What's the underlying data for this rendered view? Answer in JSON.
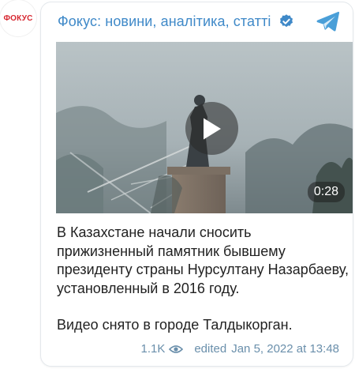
{
  "avatar": {
    "label": "ФОКУС",
    "color": "#d7262f"
  },
  "channel": {
    "title": "Фокус: новини, аналітика, статті",
    "title_color": "#3f89c8",
    "verified_icon": "verified-badge-icon",
    "share_icon": "telegram-icon"
  },
  "video": {
    "duration": "0:28",
    "play_icon": "play-icon"
  },
  "post": {
    "paragraph1": "В Казахстане начали сносить прижизненный памятник бывшему президенту страны Нурсултану Назарбаеву, установленный в 2016 году.",
    "paragraph2": "Видео снято в городе Талдыкорган."
  },
  "meta": {
    "views": "1.1K",
    "views_icon": "eye-icon",
    "edited": "edited",
    "date": "Jan 5, 2022 at 13:48"
  }
}
